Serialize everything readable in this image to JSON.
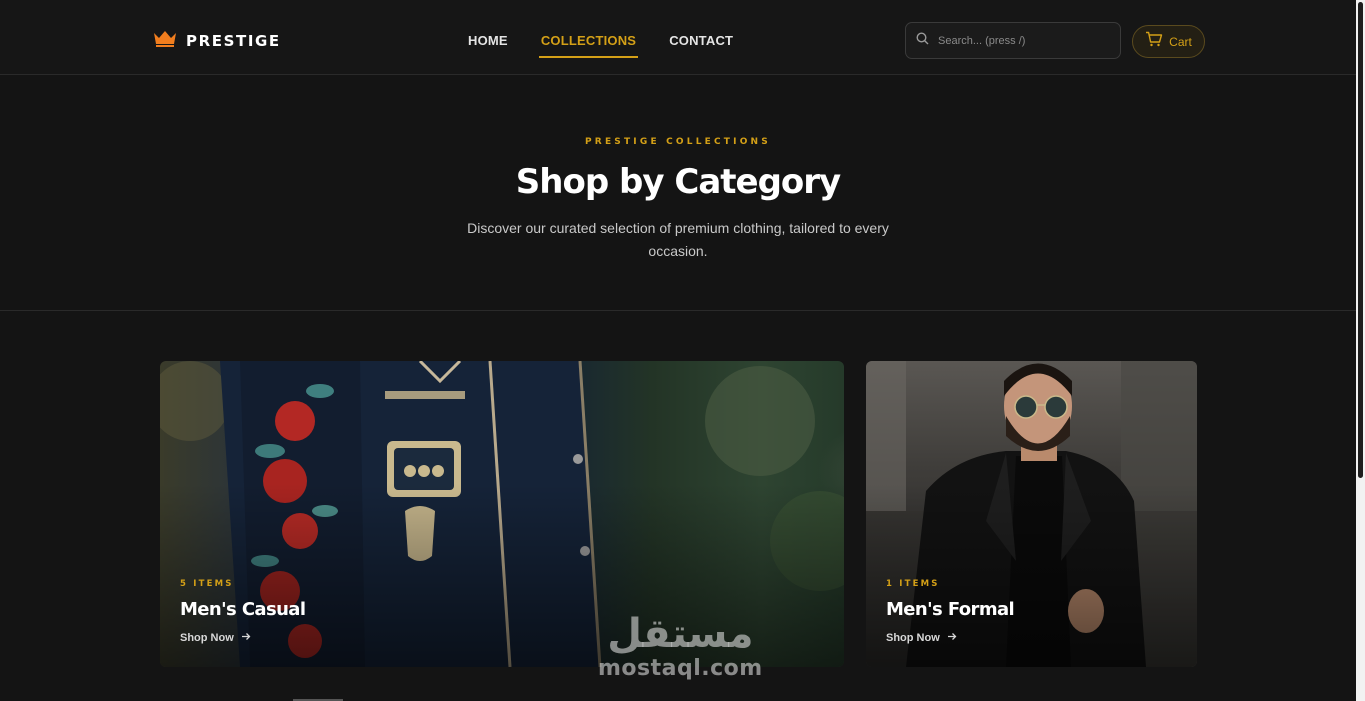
{
  "brand": {
    "name": "PRESTIGE",
    "logo_icon": "crown-icon",
    "accent": "#d4a017",
    "logo_color": "#f07d1e"
  },
  "nav": {
    "items": [
      {
        "label": "HOME",
        "active": false
      },
      {
        "label": "COLLECTIONS",
        "active": true
      },
      {
        "label": "CONTACT",
        "active": false
      }
    ]
  },
  "search": {
    "placeholder": "Search... (press /)",
    "icon": "search-icon"
  },
  "cart": {
    "label": "Cart",
    "icon": "cart-icon"
  },
  "hero": {
    "eyebrow": "PRESTIGE COLLECTIONS",
    "title": "Shop by Category",
    "subtitle": "Discover our curated selection of premium clothing, tailored to every occasion."
  },
  "categories": [
    {
      "count": "5 ITEMS",
      "title": "Men's Casual",
      "cta": "Shop Now"
    },
    {
      "count": "1 ITEMS",
      "title": "Men's Formal",
      "cta": "Shop Now"
    }
  ],
  "watermark": {
    "arabic": "مستقل",
    "latin": "mostaql.com"
  }
}
